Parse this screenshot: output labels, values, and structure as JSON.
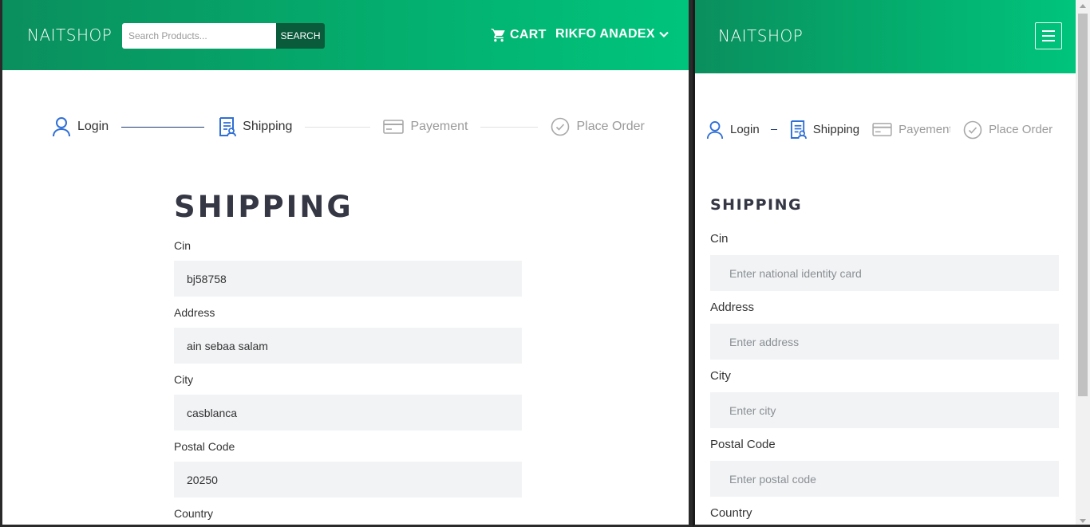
{
  "left": {
    "brand": "NAITSHOP",
    "search": {
      "placeholder": "Search Products...",
      "button": "SEARCH"
    },
    "cart_label": "CART",
    "user_label": "RIKFO ANADEX",
    "steps": [
      "Login",
      "Shipping",
      "Payement",
      "Place Order"
    ],
    "title": "SHIPPING",
    "fields": [
      {
        "label": "Cin",
        "value": "bj58758"
      },
      {
        "label": "Address",
        "value": "ain sebaa salam"
      },
      {
        "label": "City",
        "value": "casblanca"
      },
      {
        "label": "Postal Code",
        "value": "20250"
      },
      {
        "label": "Country"
      }
    ]
  },
  "right": {
    "brand": "NAITSHOP",
    "steps": [
      "Login",
      "Shipping",
      "Payement",
      "Place Order"
    ],
    "title": "SHIPPING",
    "fields": [
      {
        "label": "Cin",
        "placeholder": "Enter national identity card"
      },
      {
        "label": "Address",
        "placeholder": "Enter address"
      },
      {
        "label": "City",
        "placeholder": "Enter city"
      },
      {
        "label": "Postal Code",
        "placeholder": "Enter postal code"
      },
      {
        "label": "Country"
      }
    ]
  },
  "colors": {
    "nav_start": "#0a8f5e",
    "nav_end": "#00c47c",
    "active_step": "#2f6fd6",
    "title": "#353744",
    "field_bg": "#f2f3f5"
  },
  "icons": [
    "cart-icon",
    "chevron-down-icon",
    "user-icon",
    "document-icon",
    "credit-card-icon",
    "check-circle-icon",
    "menu-icon"
  ]
}
